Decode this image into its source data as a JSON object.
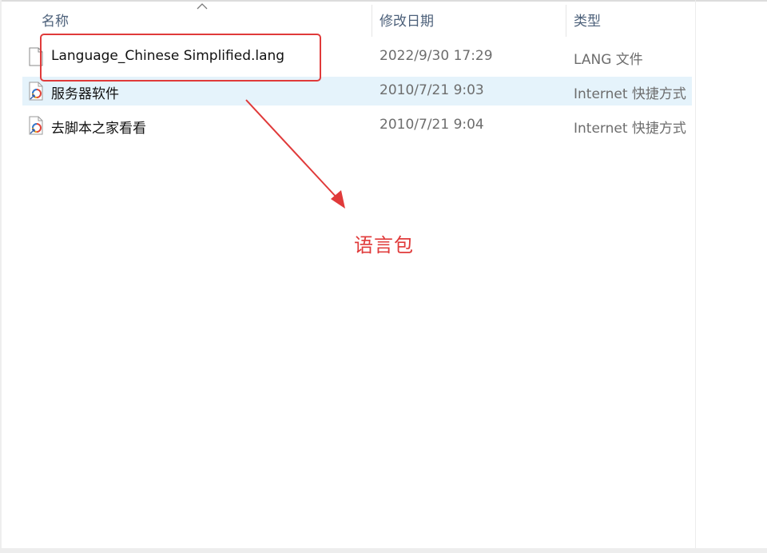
{
  "columns": {
    "name": "名称",
    "date": "修改日期",
    "type": "类型"
  },
  "files": [
    {
      "name": "Language_Chinese Simplified.lang",
      "modified": "2022/9/30 17:29",
      "type": "LANG 文件",
      "icon": "blank-file-icon",
      "selected": false
    },
    {
      "name": "服务器软件",
      "modified": "2010/7/21 9:03",
      "type": "Internet 快捷方式",
      "icon": "internet-shortcut-icon",
      "selected": true
    },
    {
      "name": "去脚本之家看看",
      "modified": "2010/7/21 9:04",
      "type": "Internet 快捷方式",
      "icon": "internet-shortcut-icon",
      "selected": false
    }
  ],
  "annotation": {
    "text": "语言包",
    "color": "#e03a3a"
  },
  "colors": {
    "selection": "#e5f3fb",
    "header_text": "#4c607a",
    "secondary_text": "#6d6d6d"
  }
}
